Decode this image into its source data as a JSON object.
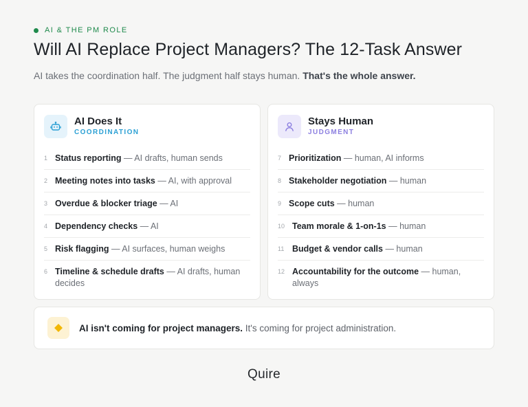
{
  "header": {
    "eyebrow": "AI & THE PM ROLE",
    "title": "Will AI Replace Project Managers? The 12-Task Answer",
    "subtitle_plain": "AI takes the coordination half. The judgment half stays human. ",
    "subtitle_bold": "That's the whole answer."
  },
  "cards": [
    {
      "title": "AI Does It",
      "subtitle": "COORDINATION",
      "icon": "robot-icon",
      "accent": "#2ba0d4",
      "tasks": [
        {
          "num": "1",
          "name": "Status reporting",
          "detail": " — AI drafts, human sends"
        },
        {
          "num": "2",
          "name": "Meeting notes into tasks",
          "detail": " — AI, with approval"
        },
        {
          "num": "3",
          "name": "Overdue & blocker triage",
          "detail": " — AI"
        },
        {
          "num": "4",
          "name": "Dependency checks",
          "detail": " — AI"
        },
        {
          "num": "5",
          "name": "Risk flagging",
          "detail": " — AI surfaces, human weighs"
        },
        {
          "num": "6",
          "name": "Timeline & schedule drafts",
          "detail": " — AI drafts, human decides"
        }
      ]
    },
    {
      "title": "Stays Human",
      "subtitle": "JUDGMENT",
      "icon": "person-icon",
      "accent": "#8c7fe0",
      "tasks": [
        {
          "num": "7",
          "name": "Prioritization",
          "detail": " — human, AI informs"
        },
        {
          "num": "8",
          "name": "Stakeholder negotiation",
          "detail": " — human"
        },
        {
          "num": "9",
          "name": "Scope cuts",
          "detail": " — human"
        },
        {
          "num": "10",
          "name": "Team morale & 1-on-1s",
          "detail": " — human"
        },
        {
          "num": "11",
          "name": "Budget & vendor calls",
          "detail": " — human"
        },
        {
          "num": "12",
          "name": "Accountability for the outcome",
          "detail": " — human, always"
        }
      ]
    }
  ],
  "callout": {
    "icon": "diamond-icon",
    "bold": "AI isn't coming for project managers.",
    "plain": " It's coming for project administration."
  },
  "brand": "Quire"
}
